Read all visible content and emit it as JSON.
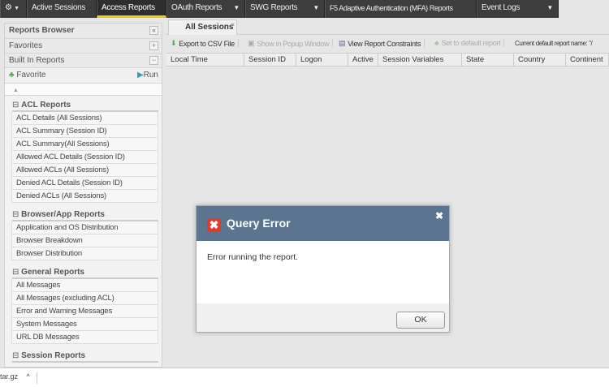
{
  "nav": {
    "items": [
      "Active Sessions",
      "Access Reports",
      "OAuth Reports",
      "SWG Reports",
      "F5 Adaptive Authentication (MFA) Reports",
      "Event Logs"
    ]
  },
  "left": {
    "title": "Reports Browser",
    "favorites": "Favorites",
    "builtin": "Built In Reports",
    "favorite_btn": "Favorite",
    "run_btn": "Run",
    "sections": [
      {
        "title": "ACL Reports",
        "items": [
          "ACL Details (All Sessions)",
          "ACL Summary (Session ID)",
          "ACL Summary(All Sessions)",
          "Allowed ACL Details (Session ID)",
          "Allowed ACLs (All Sessions)",
          "Denied ACL Details (Session ID)",
          "Denied ACLs (All Sessions)"
        ]
      },
      {
        "title": "Browser/App Reports",
        "items": [
          "Application and OS Distribution",
          "Browser Breakdown",
          "Browser Distribution"
        ]
      },
      {
        "title": "General Reports",
        "items": [
          "All Messages",
          "All Messages (excluding ACL)",
          "Error and Warning Messages",
          "System Messages",
          "URL DB Messages"
        ]
      },
      {
        "title": "Session Reports",
        "items": []
      }
    ]
  },
  "main": {
    "tab": "All Sessions",
    "toolbar": {
      "export": "Export to CSV File",
      "popup": "Show in Popup Window",
      "constraints": "View Report Constraints",
      "set_default": "Set to default report",
      "current": "Current default report name: \"/"
    },
    "columns": [
      "Local Time",
      "Session ID",
      "Logon",
      "Active",
      "Session Variables",
      "State",
      "Country",
      "Continent"
    ]
  },
  "dialog": {
    "title": "Query Error",
    "message": "Error running the report.",
    "ok": "OK"
  },
  "download": {
    "file": "tar.gz"
  }
}
